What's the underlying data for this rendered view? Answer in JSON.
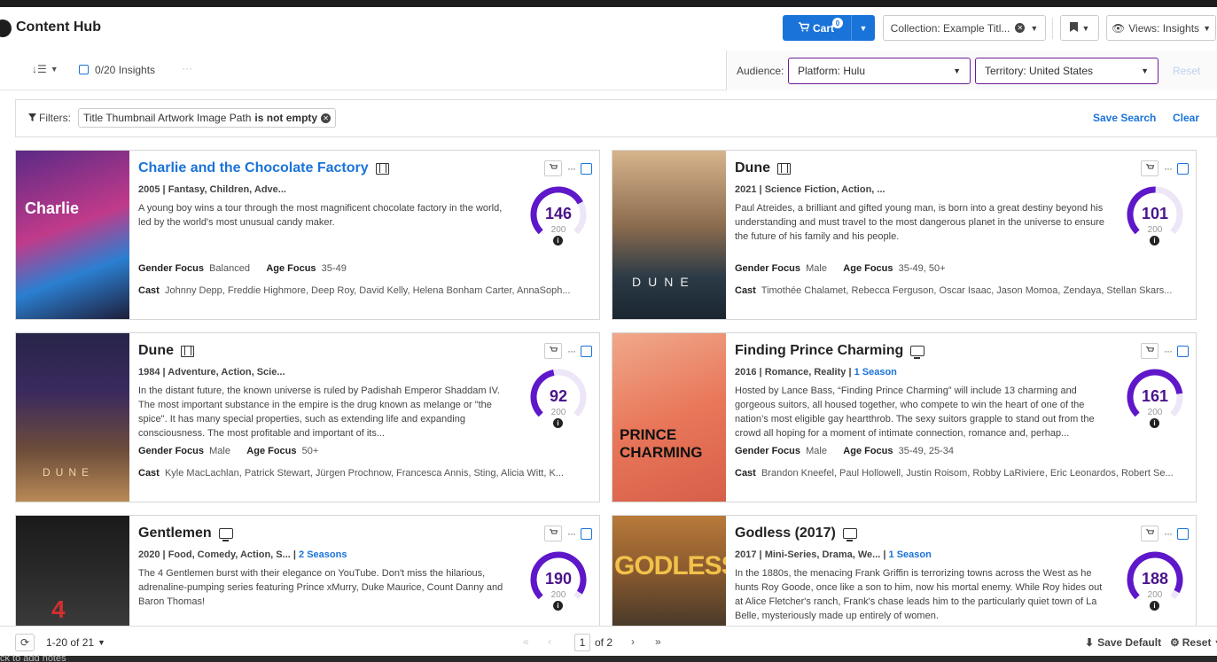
{
  "app": {
    "title": "Content Hub"
  },
  "header": {
    "cart_label": "Cart",
    "cart_count": "0",
    "collection_label": "Collection: Example Titl...",
    "views_label": "Views: Insights"
  },
  "toolbar": {
    "insights_label": "0/20 Insights",
    "audience_label": "Audience:",
    "platform_value": "Platform: Hulu",
    "territory_value": "Territory: United States",
    "reset_label": "Reset"
  },
  "filters": {
    "label": "Filters:",
    "chip_field": "Title Thumbnail Artwork Image Path",
    "chip_op": "is not empty",
    "save_search_label": "Save Search",
    "clear_label": "Clear"
  },
  "cards": [
    {
      "title": "Charlie and the Chocolate Factory",
      "media": "film-icon",
      "year": "2005",
      "genres": "Fantasy, Children, Adve...",
      "seasons": "",
      "description": "A young boy wins a tour through the most magnificent chocolate factory in the world, led by the world's most unusual candy maker.",
      "gender_focus": "Balanced",
      "age_focus": "35-49",
      "cast": "Johnny Depp, Freddie Highmore, Deep Roy, David Kelly, Helena Bonham Carter, AnnaSoph...",
      "score": 146,
      "score_max": "200",
      "poster_text": "Charlie"
    },
    {
      "title": "Dune",
      "media": "film-icon",
      "year": "2021",
      "genres": "Science Fiction, Action, ...",
      "seasons": "",
      "description": "Paul Atreides, a brilliant and gifted young man, is born into a great destiny beyond his understanding and must travel to the most dangerous planet in the universe to ensure the future of his family and his people.",
      "gender_focus": "Male",
      "age_focus": "35-49, 50+",
      "cast": "Timothée Chalamet, Rebecca Ferguson, Oscar Isaac, Jason Momoa, Zendaya, Stellan Skars...",
      "score": 101,
      "score_max": "200",
      "poster_text": "DUNE"
    },
    {
      "title": "Dune",
      "media": "film-icon",
      "year": "1984",
      "genres": "Adventure, Action, Scie...",
      "seasons": "",
      "description": "In the distant future, the known universe is ruled by Padishah Emperor Shaddam IV. The most important substance in the empire is the drug known as melange or \"the spice\". It has many special properties, such as extending life and expanding consciousness. The most profitable and important of its...",
      "gender_focus": "Male",
      "age_focus": "50+",
      "cast": "Kyle MacLachlan, Patrick Stewart, Jürgen Prochnow, Francesca Annis, Sting, Alicia Witt, K...",
      "score": 92,
      "score_max": "200",
      "poster_text": "DUNE"
    },
    {
      "title": "Finding Prince Charming",
      "media": "tv-icon",
      "year": "2016",
      "genres": "Romance, Reality",
      "seasons": "1 Season",
      "description": "Hosted by Lance Bass, “Finding Prince Charming” will include 13 charming and gorgeous suitors, all housed together, who compete to win the heart of one of the nation’s most eligible gay heartthrob. The sexy suitors grapple to stand out from the crowd all hoping for a moment of intimate connection, romance and, perhap...",
      "gender_focus": "Male",
      "age_focus": "35-49, 25-34",
      "cast": "Brandon Kneefel, Paul Hollowell, Justin Roisom, Robby LaRiviere, Eric Leonardos, Robert Se...",
      "score": 161,
      "score_max": "200",
      "poster_text": "PRINCE CHARMING"
    },
    {
      "title": "Gentlemen",
      "media": "tv-icon",
      "year": "2020",
      "genres": "Food, Comedy, Action, S...",
      "seasons": "2 Seasons",
      "description": "The 4 Gentlemen burst with their elegance on YouTube. Don't miss the hilarious, adrenaline-pumping series featuring Prince xMurry, Duke Maurice, Count Danny and Baron Thomas!",
      "gender_focus": "",
      "age_focus": "",
      "cast": "",
      "score": 190,
      "score_max": "200",
      "poster_text": "4"
    },
    {
      "title": "Godless (2017)",
      "media": "tv-icon",
      "year": "2017",
      "genres": "Mini-Series, Drama, We...",
      "seasons": "1 Season",
      "description": "In the 1880s, the menacing Frank Griffin is terrorizing towns across the West as he hunts Roy Goode, once like a son to him, now his mortal enemy. While Roy hides out at Alice Fletcher's ranch, Frank's chase leads him to the particularly quiet town of La Belle, mysteriously made up entirely of women.",
      "gender_focus": "",
      "age_focus": "",
      "cast": "",
      "score": 188,
      "score_max": "200",
      "poster_text": "GODLESS"
    }
  ],
  "labels": {
    "gender_focus": "Gender Focus",
    "age_focus": "Age Focus",
    "cast": "Cast"
  },
  "footer": {
    "range_label": "1-20 of 21",
    "page_current": "1",
    "page_of": "of 2",
    "save_default_label": "Save Default",
    "reset_label": "Reset",
    "notes_hint": "ck to add notes"
  },
  "colors": {
    "accent": "#1a73d9",
    "score_arc": "#5e17c9",
    "score_track": "#ece6f7",
    "audience_border": "#6a1b9a"
  }
}
